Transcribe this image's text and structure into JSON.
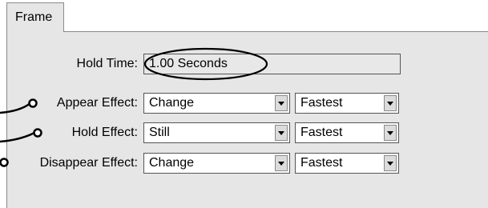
{
  "tab": {
    "label": "Frame"
  },
  "hold_time": {
    "label": "Hold Time:",
    "value": "1.00 Seconds"
  },
  "appear": {
    "label": "Appear Effect:",
    "effect": "Change",
    "speed": "Fastest"
  },
  "hold": {
    "label": "Hold Effect:",
    "effect": "Still",
    "speed": "Fastest"
  },
  "disappear": {
    "label": "Disappear Effect:",
    "effect": "Change",
    "speed": "Fastest"
  },
  "icons": {
    "dropdown": "chevron-down-icon"
  }
}
